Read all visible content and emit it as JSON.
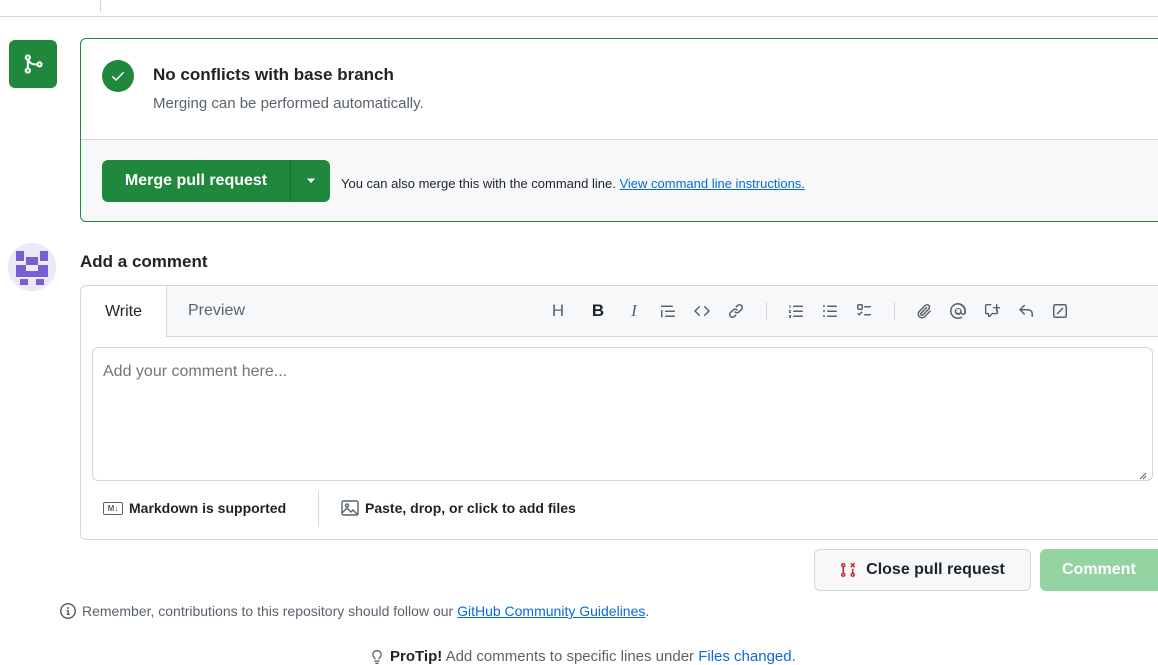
{
  "merge": {
    "title": "No conflicts with base branch",
    "subtitle": "Merging can be performed automatically.",
    "button_label": "Merge pull request",
    "note_text": "You can also merge this with the command line.",
    "note_link": "View command line instructions."
  },
  "comment": {
    "heading": "Add a comment",
    "tabs": {
      "write": "Write",
      "preview": "Preview"
    },
    "toolbar": {
      "heading": "H",
      "bold": "B",
      "italic": "I",
      "items": [
        "heading-icon",
        "bold-icon",
        "italic-icon",
        "quote-icon",
        "code-icon",
        "link-icon",
        "ordered-list-icon",
        "unordered-list-icon",
        "task-list-icon",
        "attach-icon",
        "mention-icon",
        "cross-reference-icon",
        "reply-icon",
        "fullscreen-icon"
      ]
    },
    "placeholder": "Add your comment here...",
    "markdown_label": "Markdown is supported",
    "markdown_badge": "M↓",
    "files_label": "Paste, drop, or click to add files"
  },
  "actions": {
    "close_label": "Close pull request",
    "comment_label": "Comment"
  },
  "reminder": {
    "text": "Remember, contributions to this repository should follow our",
    "link": "GitHub Community Guidelines",
    "suffix": "."
  },
  "protip": {
    "label": "ProTip!",
    "text": "Add comments to specific lines under",
    "link": "Files changed",
    "suffix": "."
  },
  "colors": {
    "accent_green": "#1f883d",
    "disabled_green": "#94d3a2",
    "link_blue": "#0969da",
    "close_red": "#cf222e"
  }
}
